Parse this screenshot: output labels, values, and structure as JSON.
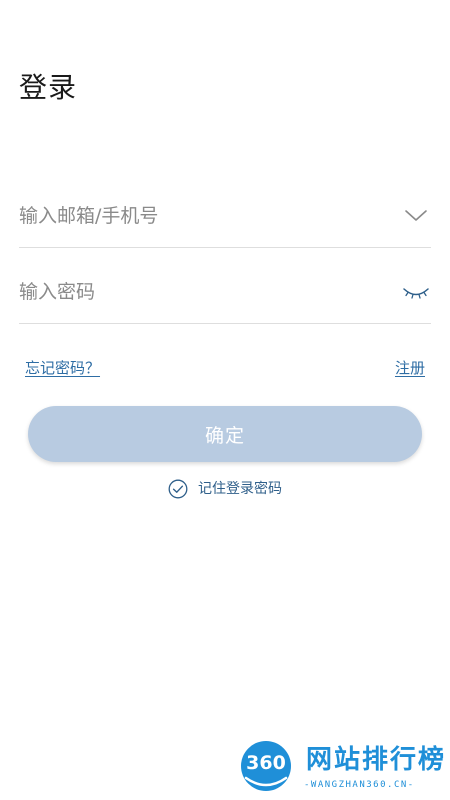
{
  "page": {
    "title": "登录"
  },
  "form": {
    "account_placeholder": "输入邮箱/手机号",
    "account_value": "",
    "password_placeholder": "输入密码",
    "password_value": "",
    "account_dropdown_icon": "chevron-down-icon",
    "password_visibility_icon": "eye-closed-icon"
  },
  "links": {
    "forgot_password": "忘记密码？",
    "register": "注册"
  },
  "actions": {
    "confirm_label": "确定"
  },
  "remember": {
    "label": "记住登录密码",
    "checked": true,
    "icon": "check-circle-icon"
  },
  "watermark": {
    "logo_number": "360",
    "site_name": "网站排行榜",
    "url_text": "-WANGZHAN360.CN-"
  },
  "colors": {
    "link": "#2e6da4",
    "button_bg": "#b8cbe1",
    "button_text": "#ffffff",
    "divider": "#dedede",
    "watermark_blue": "#1f8fd8"
  }
}
